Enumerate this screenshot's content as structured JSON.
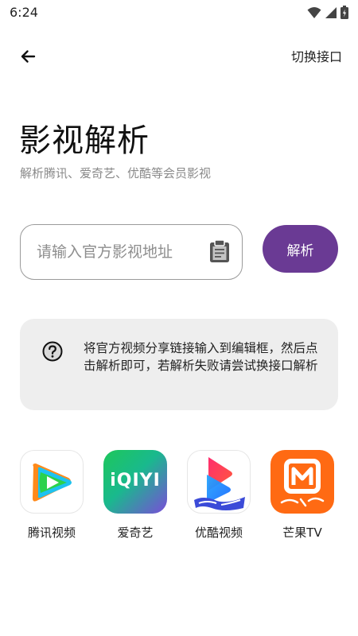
{
  "status_bar": {
    "time": "6:24"
  },
  "app_bar": {
    "switch_label": "切换接口"
  },
  "header": {
    "title": "影视解析",
    "subtitle": "解析腾讯、爱奇艺、优酷等会员影视"
  },
  "search": {
    "placeholder": "请输入官方影视地址",
    "value": "",
    "button_label": "解析"
  },
  "tip": {
    "text": "将官方视频分享链接输入到编辑框，然后点击解析即可，若解析失败请尝试换接口解析"
  },
  "platforms": {
    "items": [
      {
        "label": "腾讯视频",
        "icon": "tencent-video-logo"
      },
      {
        "label": "爱奇艺",
        "icon": "iqiyi-logo",
        "logo_text": "iQIYI"
      },
      {
        "label": "优酷视频",
        "icon": "youku-logo"
      },
      {
        "label": "芒果TV",
        "icon": "mango-tv-logo"
      }
    ]
  },
  "colors": {
    "accent": "#6a3a94",
    "card_background": "#eeeeee",
    "iqiyi_green": "#1ec75a",
    "mango_orange": "#ff6a13"
  }
}
